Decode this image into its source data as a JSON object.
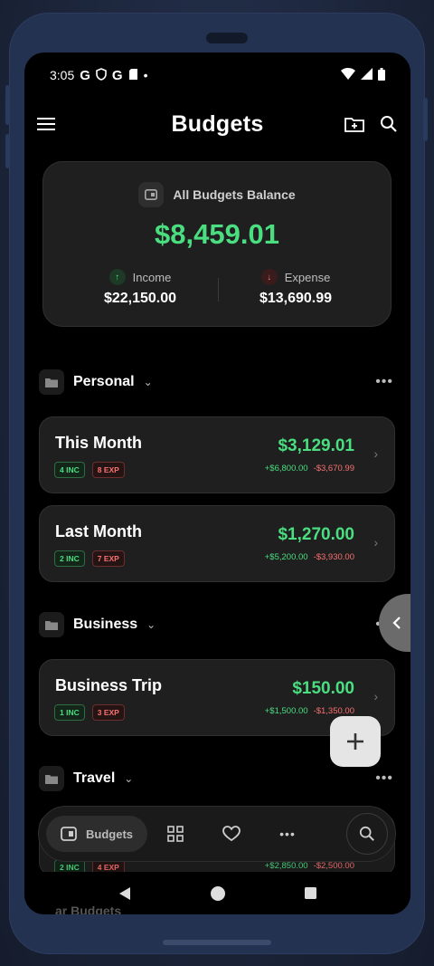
{
  "status": {
    "time": "3:05",
    "left_icons": [
      "G",
      "shield-icon",
      "G",
      "sd-card-icon",
      "•"
    ],
    "right_icons": [
      "wifi-icon",
      "signal-icon",
      "battery-icon"
    ]
  },
  "appbar": {
    "title": "Budgets",
    "menu_icon": "menu-icon",
    "add_folder_icon": "folder-add-icon",
    "search_icon": "search-icon"
  },
  "balance": {
    "label": "All Budgets Balance",
    "amount": "$8,459.01",
    "income_label": "Income",
    "income_value": "$22,150.00",
    "expense_label": "Expense",
    "expense_value": "$13,690.99"
  },
  "groups": [
    {
      "name": "Personal"
    },
    {
      "name": "Business"
    },
    {
      "name": "Travel"
    }
  ],
  "budgets": [
    {
      "name": "This Month",
      "inc": "4 INC",
      "exp": "8 EXP",
      "total": "$3,129.01",
      "plus": "+$6,800.00",
      "minus": "-$3,670.99"
    },
    {
      "name": "Last Month",
      "inc": "2 INC",
      "exp": "7 EXP",
      "total": "$1,270.00",
      "plus": "+$5,200.00",
      "minus": "-$3,930.00"
    },
    {
      "name": "Business Trip",
      "inc": "1 INC",
      "exp": "3 EXP",
      "total": "$150.00",
      "plus": "+$1,500.00",
      "minus": "-$1,350.00"
    },
    {
      "name": "",
      "inc": "2 INC",
      "exp": "4 EXP",
      "total": "",
      "plus": "+$2,850.00",
      "minus": "-$2,500.00"
    }
  ],
  "bottom_nav": {
    "active_label": "Budgets",
    "items": [
      "budgets-icon",
      "grid-icon",
      "heart-icon",
      "more-icon",
      "search-icon"
    ]
  },
  "peek_text": "ar Budgets",
  "colors": {
    "income": "#4ade80",
    "expense": "#f87171",
    "card": "#1f1f1f"
  }
}
